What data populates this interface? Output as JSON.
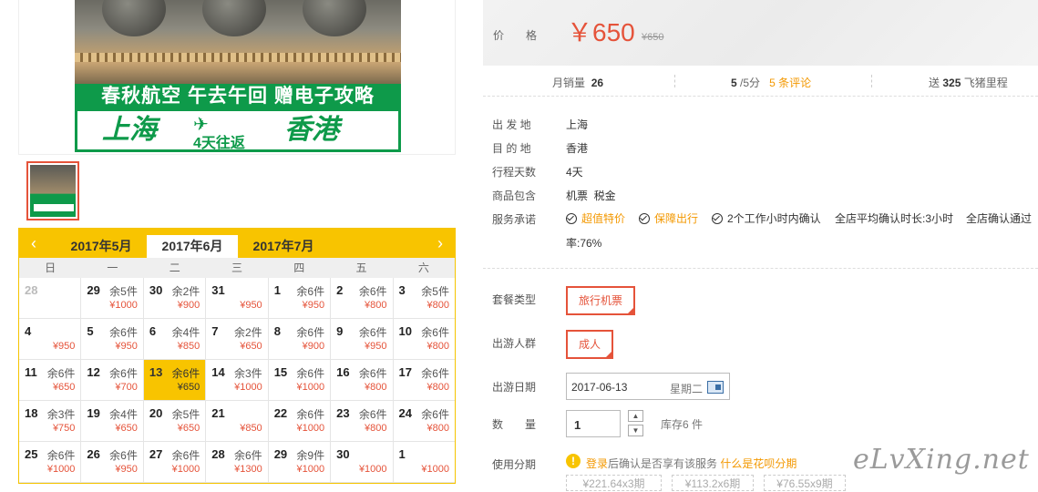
{
  "banner": {
    "line1": "春秋航空  午去午回  赠电子攻略",
    "city_from": "上海",
    "days": "4天往返",
    "city_to": "香港"
  },
  "calendar": {
    "months": [
      "2017年5月",
      "2017年6月",
      "2017年7月"
    ],
    "active_month": "2017年6月",
    "weekdays": [
      "日",
      "一",
      "二",
      "三",
      "四",
      "五",
      "六"
    ],
    "weeks": [
      [
        {
          "d": "28",
          "s": "",
          "p": ""
        },
        {
          "d": "29",
          "s": "余5件",
          "p": "¥1000"
        },
        {
          "d": "30",
          "s": "余2件",
          "p": "¥900"
        },
        {
          "d": "31",
          "s": "",
          "p": "¥950"
        },
        {
          "d": "1",
          "s": "余6件",
          "p": "¥950"
        },
        {
          "d": "2",
          "s": "余6件",
          "p": "¥800"
        },
        {
          "d": "3",
          "s": "余5件",
          "p": "¥800"
        }
      ],
      [
        {
          "d": "4",
          "s": "",
          "p": "¥950"
        },
        {
          "d": "5",
          "s": "余6件",
          "p": "¥950"
        },
        {
          "d": "6",
          "s": "余4件",
          "p": "¥850"
        },
        {
          "d": "7",
          "s": "余2件",
          "p": "¥650"
        },
        {
          "d": "8",
          "s": "余6件",
          "p": "¥900"
        },
        {
          "d": "9",
          "s": "余6件",
          "p": "¥950"
        },
        {
          "d": "10",
          "s": "余6件",
          "p": "¥800"
        }
      ],
      [
        {
          "d": "11",
          "s": "余6件",
          "p": "¥650"
        },
        {
          "d": "12",
          "s": "余6件",
          "p": "¥700"
        },
        {
          "d": "13",
          "s": "余6件",
          "p": "¥650"
        },
        {
          "d": "14",
          "s": "余3件",
          "p": "¥1000"
        },
        {
          "d": "15",
          "s": "余6件",
          "p": "¥1000"
        },
        {
          "d": "16",
          "s": "余6件",
          "p": "¥800"
        },
        {
          "d": "17",
          "s": "余6件",
          "p": "¥800"
        }
      ],
      [
        {
          "d": "18",
          "s": "余3件",
          "p": "¥750"
        },
        {
          "d": "19",
          "s": "余4件",
          "p": "¥650"
        },
        {
          "d": "20",
          "s": "余5件",
          "p": "¥650"
        },
        {
          "d": "21",
          "s": "",
          "p": "¥850"
        },
        {
          "d": "22",
          "s": "余6件",
          "p": "¥1000"
        },
        {
          "d": "23",
          "s": "余6件",
          "p": "¥800"
        },
        {
          "d": "24",
          "s": "余6件",
          "p": "¥800"
        }
      ],
      [
        {
          "d": "25",
          "s": "余6件",
          "p": "¥1000"
        },
        {
          "d": "26",
          "s": "余6件",
          "p": "¥950"
        },
        {
          "d": "27",
          "s": "余6件",
          "p": "¥1000"
        },
        {
          "d": "28",
          "s": "余6件",
          "p": "¥1300"
        },
        {
          "d": "29",
          "s": "余9件",
          "p": "¥1000"
        },
        {
          "d": "30",
          "s": "",
          "p": "¥1000"
        },
        {
          "d": "1",
          "s": "",
          "p": "¥1000"
        }
      ]
    ],
    "selected_day": "13"
  },
  "price": {
    "label": "价　　格",
    "current": "￥650",
    "original": "¥650"
  },
  "stats": {
    "sales_label": "月销量",
    "sales": "26",
    "rating": "5",
    "rating_suffix": "/5分",
    "reviews": "5 条评论",
    "miles_prefix": "送",
    "miles": "325",
    "miles_suffix": "飞猪里程"
  },
  "info": {
    "depart_label": "出 发 地",
    "depart": "上海",
    "dest_label": "目 的 地",
    "dest": "香港",
    "days_label": "行程天数",
    "days": "4天",
    "includes_label": "商品包含",
    "includes": "机票  税金",
    "promise_label": "服务承诺",
    "promises": [
      "超值特价",
      "保障出行",
      "2个工作小时内确认"
    ],
    "promise_extra": "全店平均确认时长:3小时",
    "promise_extra2": "全店确认通过",
    "promise_rate": "率:76%"
  },
  "options": {
    "package_label": "套餐类型",
    "package": "旅行机票",
    "group_label": "出游人群",
    "group": "成人",
    "date_label": "出游日期",
    "date": "2017-06-13",
    "weekday": "星期二",
    "qty_label": "数　　量",
    "qty": "1",
    "stock": "库存6 件",
    "installment_label": "使用分期",
    "login": "登录",
    "installment_note": "后确认是否享有该服务",
    "huabei": "什么是花呗分期",
    "plans": [
      "¥221.64x3期",
      "¥113.2x6期",
      "¥76.55x9期"
    ]
  },
  "watermark": "eLvXing.net",
  "colors": {
    "accent": "#e5533a",
    "calendar": "#f8c400",
    "link": "#f39800"
  }
}
